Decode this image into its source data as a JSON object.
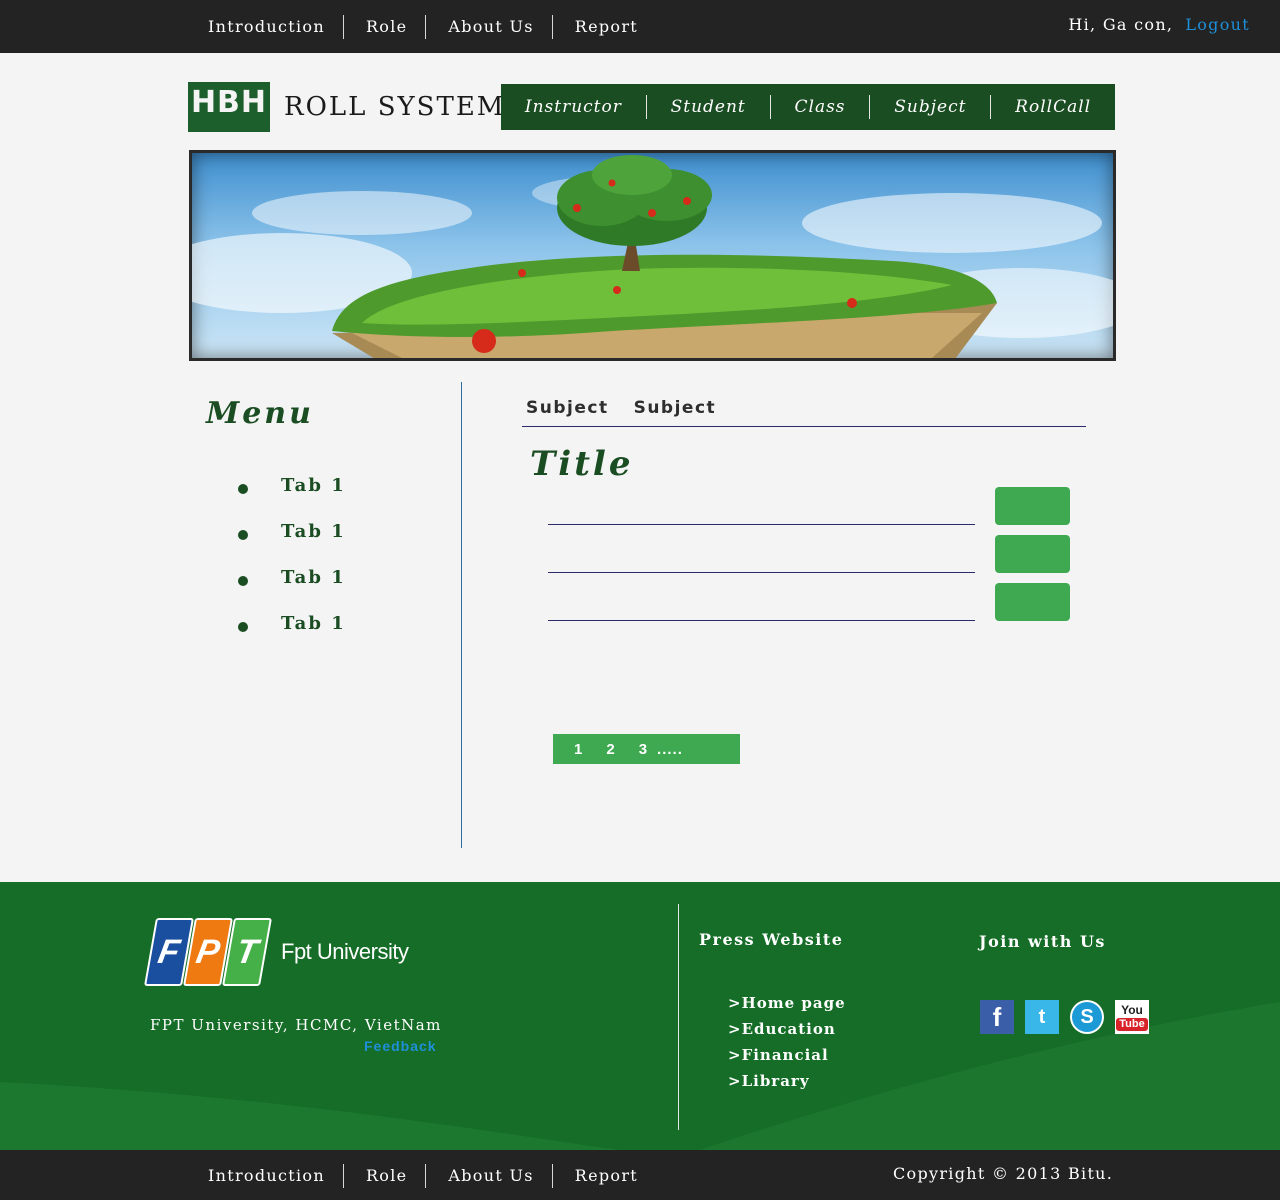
{
  "top_nav": {
    "links": [
      "Introduction",
      "Role",
      "About Us",
      "Report"
    ],
    "greeting": "Hi, Ga con,",
    "logout": "Logout"
  },
  "header": {
    "logo_mark": "HBH",
    "logo_title": "ROLL SYSTEM",
    "nav": [
      "Instructor",
      "Student",
      "Class",
      "Subject",
      "RollCall"
    ]
  },
  "sidebar": {
    "title": "Menu",
    "items": [
      "Tab 1",
      "Tab 1",
      "Tab 1",
      "Tab 1"
    ]
  },
  "content": {
    "breadcrumbs": [
      "Subject",
      "Subject"
    ],
    "title": "Title",
    "pager": {
      "pages": [
        "1",
        "2",
        "3"
      ],
      "more": "....."
    }
  },
  "footer": {
    "logo_letters": [
      "F",
      "P",
      "T"
    ],
    "university_name": "Fpt University",
    "address": "FPT University, HCMC, VietNam",
    "feedback": "Feedback",
    "press_heading": "Press Website",
    "press_links": [
      ">Home page",
      ">Education",
      ">Financial",
      ">Library"
    ],
    "join_heading": "Join with Us",
    "social": [
      {
        "icon": "facebook-icon",
        "glyph": "f",
        "color": "#3b5ea8"
      },
      {
        "icon": "twitter-icon",
        "glyph": "t",
        "color": "#39b7e8"
      },
      {
        "icon": "skype-icon",
        "glyph": "S",
        "color": "#1c9ad6"
      },
      {
        "icon": "youtube-icon",
        "glyph_top": "You",
        "glyph_bottom": "Tube",
        "color": "#d8232a"
      }
    ]
  },
  "bottom_nav": {
    "links": [
      "Introduction",
      "Role",
      "About Us",
      "Report"
    ],
    "copyright": "Copyright © 2013 Bitu."
  },
  "colors": {
    "dark_bar": "#232323",
    "brand_green": "#1b4d23",
    "button_green": "#3ea951",
    "footer_green": "#156d27",
    "link_blue": "#1f8fd8"
  }
}
